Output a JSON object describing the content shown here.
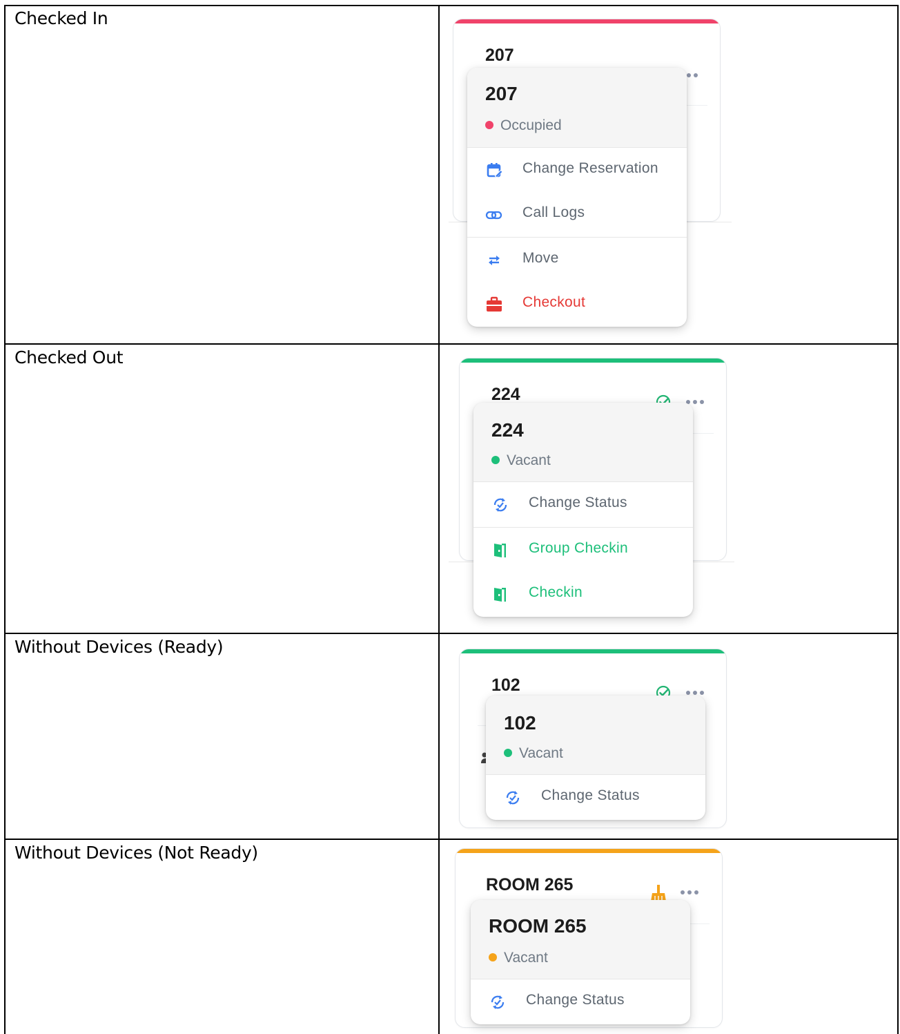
{
  "rows": [
    {
      "label": "Checked In",
      "card": {
        "room": "207",
        "accent": "#f0436a",
        "status_icon": "check-circle-icon",
        "status_icon_color": "#22b573"
      },
      "popup": {
        "room": "207",
        "status": "Occupied",
        "status_color": "#f0436a",
        "items": [
          {
            "label": "Change Reservation",
            "icon": "calendar-edit-icon",
            "color": "#3b7df0"
          },
          {
            "label": "Call Logs",
            "icon": "link-icon",
            "color": "#3b7df0"
          },
          {
            "label": "Move",
            "icon": "swap-arrows-icon",
            "color": "#3b7df0"
          },
          {
            "label": "Checkout",
            "icon": "briefcase-icon",
            "color": "#e53935"
          }
        ]
      }
    },
    {
      "label": "Checked Out",
      "card": {
        "room": "224",
        "accent": "#1dbf7a",
        "status_icon": "check-circle-icon",
        "status_icon_color": "#22b573"
      },
      "popup": {
        "room": "224",
        "status": "Vacant",
        "status_color": "#1dbf7a",
        "items": [
          {
            "label": "Change Status",
            "icon": "refresh-check-icon",
            "color": "#3b7df0"
          },
          {
            "label": "Group Checkin",
            "icon": "door-icon",
            "color": "#1dbf7a"
          },
          {
            "label": "Checkin",
            "icon": "door-icon",
            "color": "#1dbf7a"
          }
        ]
      }
    },
    {
      "label": "Without Devices (Ready)",
      "card": {
        "room": "102",
        "accent": "#1dbf7a",
        "status_icon": "check-circle-icon",
        "status_icon_color": "#22b573"
      },
      "popup": {
        "room": "102",
        "status": "Vacant",
        "status_color": "#1dbf7a",
        "items": [
          {
            "label": "Change Status",
            "icon": "refresh-check-icon",
            "color": "#3b7df0"
          }
        ]
      }
    },
    {
      "label": "Without Devices (Not Ready)",
      "card": {
        "room": "ROOM 265",
        "accent": "#f5a31a",
        "status_icon": "broom-icon",
        "status_icon_color": "#f5a31a"
      },
      "popup": {
        "room": "ROOM 265",
        "status": "Vacant",
        "status_color": "#f5a31a",
        "items": [
          {
            "label": "Change Status",
            "icon": "refresh-check-icon",
            "color": "#3b7df0"
          }
        ]
      }
    }
  ]
}
